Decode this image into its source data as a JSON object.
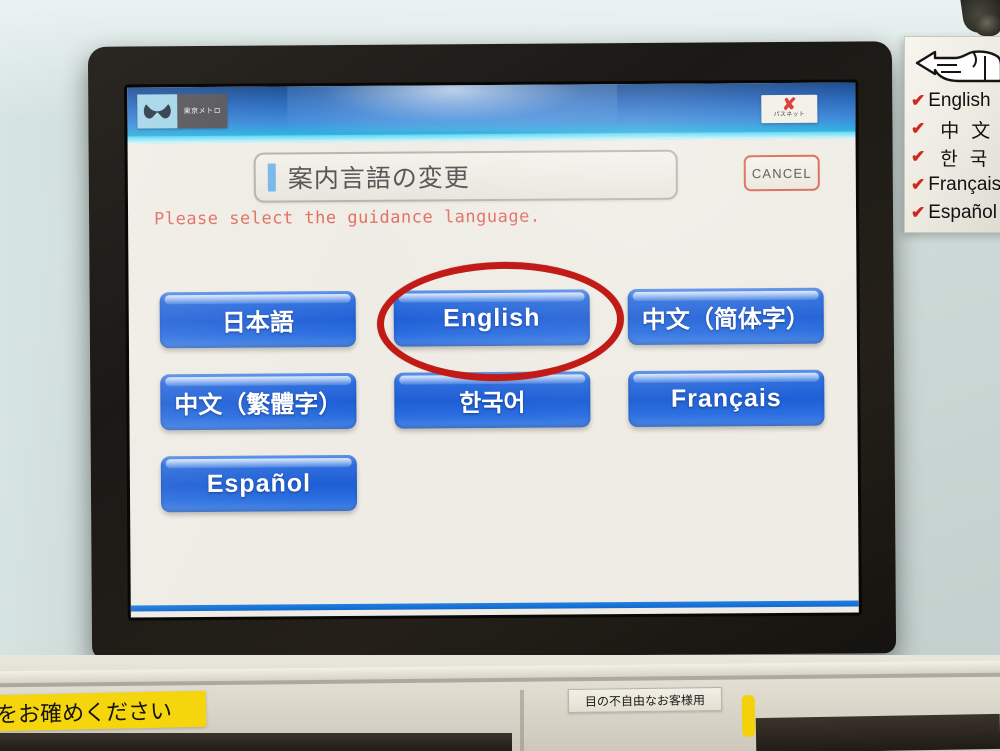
{
  "scene": {
    "description": "Tokyo Metro ticket vending machine touchscreen showing guidance language selection"
  },
  "screen": {
    "header": {
      "operator_logo_name": "tokyo-metro-logo",
      "operator_name_ja": "東京メトロ",
      "passnet_logo_name": "passnet-logo",
      "passnet_mark": "✘",
      "passnet_text": "パスネット"
    },
    "title": "案内言語の変更",
    "cancel_label": "CANCEL",
    "instruction": "Please select the guidance language.",
    "language_buttons": [
      [
        {
          "label": "日本語",
          "script": "cjk",
          "highlighted": false
        },
        {
          "label": "English",
          "script": "latin",
          "highlighted": true
        },
        {
          "label": "中文（简体字）",
          "script": "cjk",
          "highlighted": false
        }
      ],
      [
        {
          "label": "中文（繁體字）",
          "script": "cjk",
          "highlighted": false
        },
        {
          "label": "한국어",
          "script": "cjk",
          "highlighted": false
        },
        {
          "label": "Français",
          "script": "latin",
          "highlighted": false
        }
      ],
      [
        {
          "label": "Español",
          "script": "latin",
          "highlighted": false
        }
      ]
    ]
  },
  "annotation": {
    "type": "ellipse",
    "target": "English",
    "color": "#c21a17"
  },
  "side_sign": {
    "icon": "pointing-hand-icon",
    "check_mark": "✔",
    "items": [
      {
        "label": "English",
        "wide": false
      },
      {
        "label": "中文",
        "wide": true
      },
      {
        "label": "한국어",
        "wide": true
      },
      {
        "label": "Français",
        "wide": false
      },
      {
        "label": "Español",
        "wide": false
      }
    ]
  },
  "counter": {
    "yellow_label": "をお確めください",
    "accessibility_plate": "目の不自由なお客様用"
  },
  "colors": {
    "button_blue": "#1f5fd6",
    "header_blue": "#1b5fb8",
    "annotation_red": "#c21a17",
    "instruction_red": "#e0685c",
    "cancel_border": "#d6654e",
    "yellow": "#f5d50c"
  }
}
